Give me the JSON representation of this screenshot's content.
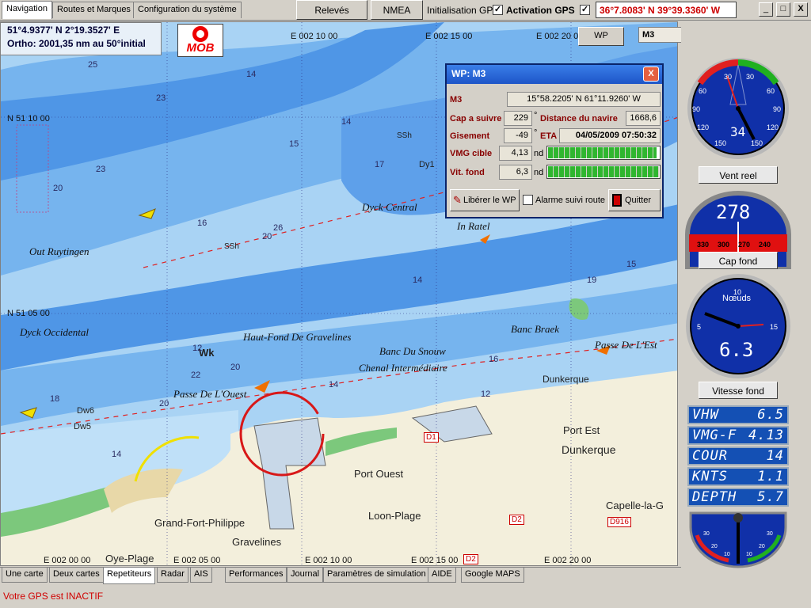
{
  "top_tabs": [
    {
      "label": "Navigation"
    },
    {
      "label": "Routes et Marques"
    },
    {
      "label": "Configuration du système"
    }
  ],
  "buttons": {
    "releves": "Relevés",
    "nmea": "NMEA",
    "wp": "WP",
    "close_x": "X"
  },
  "gps": {
    "init_label": "Initialisation GPS",
    "init_checked": "✓",
    "activation_label": "Activation GPS",
    "activation_checked": "✓",
    "position": "36°7.8083' N 39°39.3360' W"
  },
  "window_controls": {
    "minimize": "_",
    "maximize": "□",
    "close": "X"
  },
  "waypoint_field": {
    "value": "M3"
  },
  "position_box": {
    "line1": "51°4.9377' N   2°19.3527' E",
    "line2": "Ortho: 2001,35 nm au 50°initial"
  },
  "mob": {
    "label": "MOB"
  },
  "map": {
    "grid_labels": [
      {
        "text": "E 002 10 00"
      },
      {
        "text": "E 002 15 00"
      },
      {
        "text": "E 002 20 00"
      },
      {
        "text": "N 51 10 00"
      },
      {
        "text": "N 51 05 00"
      },
      {
        "text": "E 002 00 00"
      },
      {
        "text": "E 002 05 00"
      },
      {
        "text": "E 002 10 00"
      },
      {
        "text": "E 002 15 00"
      },
      {
        "text": "E 002 20 00"
      }
    ],
    "banks": [
      {
        "text": "Out Ruytingen"
      },
      {
        "text": "Dyck Occidental"
      },
      {
        "text": "Haut-Fond De Gravelines"
      },
      {
        "text": "Banc Du Snouw"
      },
      {
        "text": "Chenal Intermédiaire"
      },
      {
        "text": "Passe De L'Ouest"
      },
      {
        "text": "Dyck Central"
      },
      {
        "text": "In Ratel"
      },
      {
        "text": "Banc Braek"
      },
      {
        "text": "Passe De L'Est"
      }
    ],
    "places": [
      {
        "text": "Grand-Fort-Philippe"
      },
      {
        "text": "Gravelines"
      },
      {
        "text": "Port Ouest"
      },
      {
        "text": "Loon-Plage"
      },
      {
        "text": "Dunkerque"
      },
      {
        "text": "Port Est"
      },
      {
        "text": "Capelle-la-G"
      },
      {
        "text": "Dunkerque"
      },
      {
        "text": "Oye-Plage"
      }
    ],
    "roads": [
      {
        "text": "D1"
      },
      {
        "text": "D2"
      },
      {
        "text": "D916"
      },
      {
        "text": "D2"
      }
    ],
    "marks": [
      {
        "text": "Dw6"
      },
      {
        "text": "Dw5"
      },
      {
        "text": "Wk"
      },
      {
        "text": "Dy1"
      },
      {
        "text": "SSh"
      },
      {
        "text": "SSh"
      }
    ],
    "depths": [
      "25",
      "23",
      "14",
      "15",
      "17",
      "20",
      "26",
      "20",
      "23",
      "14",
      "17",
      "15",
      "14",
      "20",
      "22",
      "12",
      "16",
      "14",
      "19",
      "16",
      "12",
      "20",
      "14",
      "18",
      "15"
    ]
  },
  "wp_dialog": {
    "title": "WP: M3",
    "close": "X",
    "name_label": "M3",
    "name_value": "15°58.2205' N 61°11.9260' W",
    "cap_label": "Cap a suivre",
    "cap_value": "229",
    "dist_label": "Distance du navire",
    "dist_value": "1668,6",
    "gis_label": "Gisement",
    "gis_value": "-49",
    "eta_label": "ETA",
    "eta_value": "04/05/2009 07:50:32",
    "vmg_label": "VMG cible",
    "vmg_value": "4,13",
    "vmg_unit": "nd",
    "vmg_fill": 0.98,
    "vit_label": "Vit. fond",
    "vit_value": "6,3",
    "vit_unit": "nd",
    "vit_fill": 1.0,
    "deg1": "°",
    "deg2": "°",
    "release_btn": "Libérer le WP",
    "alarm_label": "Alarme suivi route",
    "quit_btn": "Quitter"
  },
  "instruments": {
    "wind": {
      "label": "Vent reel",
      "value": "34",
      "ticks": [
        "30",
        "60",
        "90",
        "120",
        "150",
        "30",
        "60",
        "90",
        "120",
        "150"
      ]
    },
    "heading": {
      "label": "Cap fond",
      "value": "278",
      "ticks": [
        "330",
        "300",
        "270",
        "240"
      ]
    },
    "speed": {
      "label": "Vitesse fond",
      "unit": "Nœuds",
      "value": "6.3",
      "ticks": [
        "5",
        "10",
        "15"
      ]
    },
    "readouts": [
      {
        "name": "VHW",
        "value": "6.5"
      },
      {
        "name": "VMG-F",
        "value": "4.13"
      },
      {
        "name": "COUR",
        "value": "14"
      },
      {
        "name": "KNTS",
        "value": "1.1"
      },
      {
        "name": "DEPTH",
        "value": "5.7"
      }
    ],
    "heel": {
      "ticks": [
        "30",
        "20",
        "10",
        "10",
        "20",
        "30"
      ]
    }
  },
  "bottom_tabs": [
    {
      "label": "Une carte"
    },
    {
      "label": "Deux cartes"
    },
    {
      "label": "Repetiteurs"
    },
    {
      "label": "Radar"
    },
    {
      "label": "AIS"
    },
    {
      "label": "Performances"
    },
    {
      "label": "Journal"
    },
    {
      "label": "Paramètres de simulation"
    },
    {
      "label": "AIDE"
    },
    {
      "label": "Google MAPS"
    }
  ],
  "status": {
    "text": "Votre GPS est INACTIF"
  },
  "colors": {
    "sea_shallow": "#a9d3f4",
    "sea_deep": "#4f96e6",
    "land": "#f3efdc",
    "accent_red": "#e00000",
    "title_blue": "#1d55c8"
  }
}
